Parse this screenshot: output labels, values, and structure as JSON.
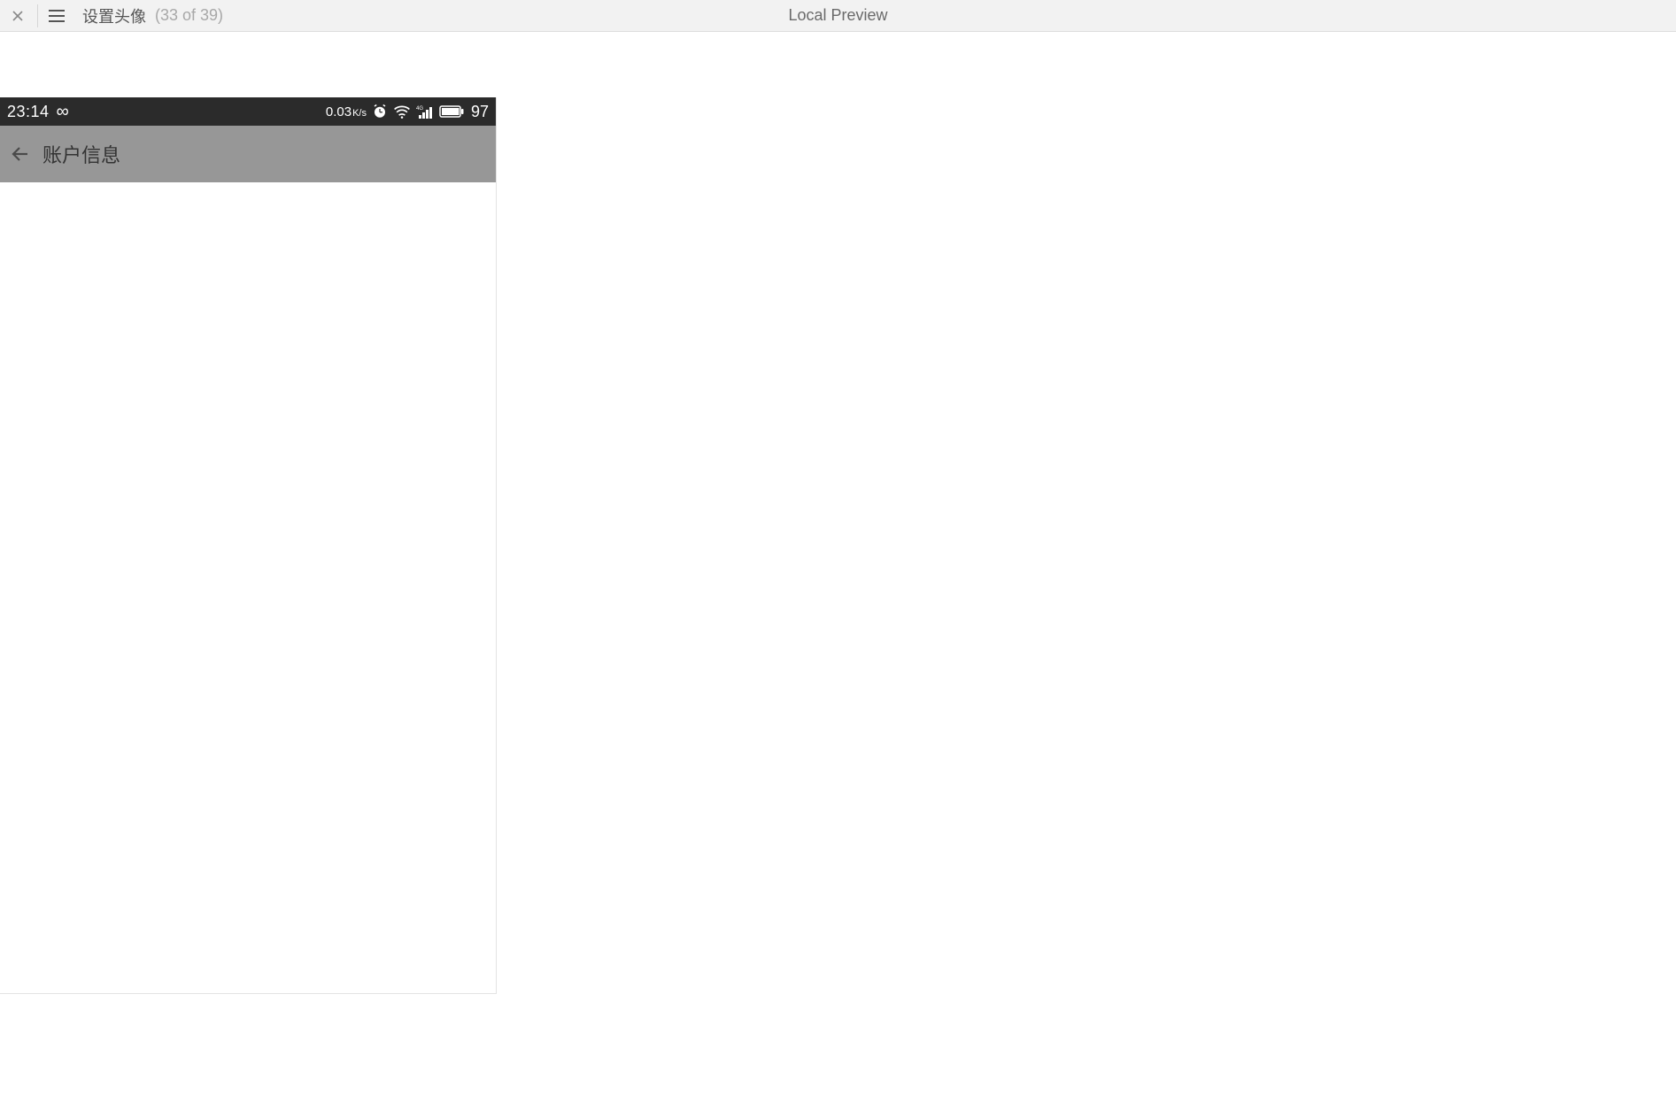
{
  "toolbar": {
    "title": "设置头像",
    "count": "(33 of 39)",
    "center_label": "Local Preview"
  },
  "status_bar": {
    "time": "23:14",
    "net_speed": "0.03",
    "net_unit": "K/s",
    "battery_pct": "97"
  },
  "app_header": {
    "title": "账户信息"
  }
}
